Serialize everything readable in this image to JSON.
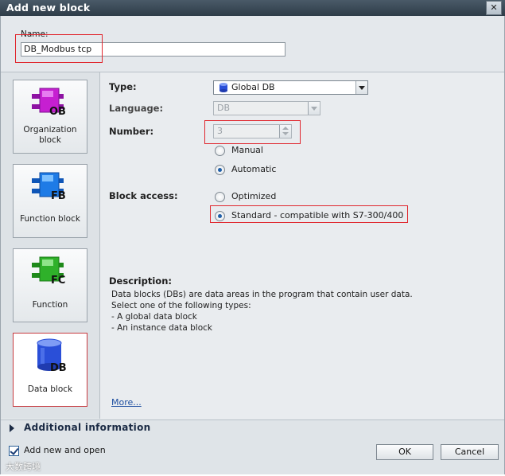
{
  "window": {
    "title": "Add new block",
    "close_label": "✕"
  },
  "name": {
    "label": "Name:",
    "value": "DB_Modbus tcp"
  },
  "blocks": [
    {
      "code": "OB",
      "label_lines": [
        "Organization",
        "block"
      ],
      "color": "#c61fd1"
    },
    {
      "code": "FB",
      "label_lines": [
        "Function block"
      ],
      "color": "#1e7be6"
    },
    {
      "code": "FC",
      "label_lines": [
        "Function"
      ],
      "color": "#2fb12a"
    },
    {
      "code": "DB",
      "label_lines": [
        "Data block"
      ],
      "color": "#2a4fd8",
      "selected": true
    }
  ],
  "form": {
    "type_label": "Type:",
    "type_value": "Global DB",
    "language_label": "Language:",
    "language_value": "DB",
    "number_label": "Number:",
    "number_value": "3",
    "number_mode_options": [
      {
        "label": "Manual",
        "checked": false
      },
      {
        "label": "Automatic",
        "checked": true
      }
    ],
    "block_access_label": "Block access:",
    "block_access_options": [
      {
        "label": "Optimized",
        "checked": false
      },
      {
        "label": "Standard - compatible with S7-300/400",
        "checked": true
      }
    ]
  },
  "description": {
    "title": "Description:",
    "lines": [
      "Data blocks (DBs) are data areas in the program that contain user data.",
      "Select one of the following types:",
      "- A global data block",
      "- An instance data block"
    ],
    "more_link": "More..."
  },
  "additional_info_label": "Additional  information",
  "footer": {
    "add_and_open_label": "Add new and open",
    "add_and_open_checked": true,
    "ok_label": "OK",
    "cancel_label": "Cancel",
    "watermark": "大数跨境"
  },
  "colors": {
    "highlight": "#e0272e",
    "link": "#1f4fa0",
    "title_bar": "#3a4856"
  }
}
